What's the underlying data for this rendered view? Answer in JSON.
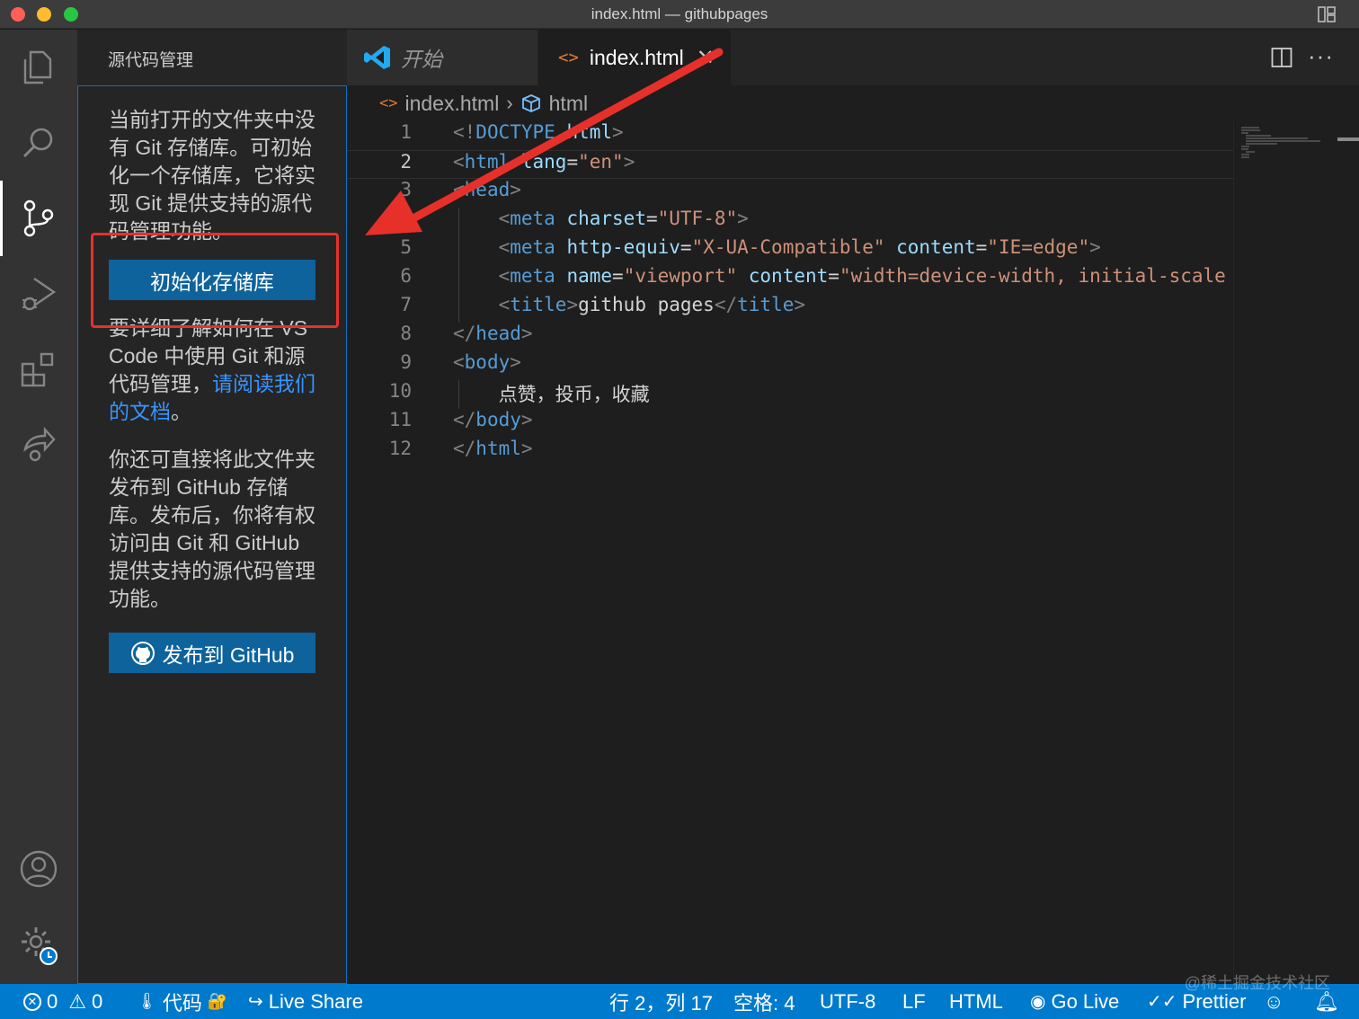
{
  "window": {
    "title": "index.html — githubpages"
  },
  "sidebar": {
    "header": "源代码管理",
    "intro": "当前打开的文件夹中没有 Git 存储库。可初始化一个存储库，它将实现 Git 提供支持的源代码管理功能。",
    "init_button": "初始化存储库",
    "learn_text": "要详细了解如何在 VS Code 中使用 Git 和源代码管理，",
    "learn_link": "请阅读我们的文档",
    "learn_suffix": "。",
    "publish_text": "你还可直接将此文件夹发布到 GitHub 存储库。发布后，你将有权访问由 Git 和 GitHub 提供支持的源代码管理功能。",
    "publish_button": "发布到 GitHub"
  },
  "tabs": [
    {
      "label": "开始",
      "icon": "vscode-logo-icon"
    },
    {
      "label": "index.html",
      "icon": "html-file-icon",
      "active": true
    }
  ],
  "breadcrumb": {
    "file": "index.html",
    "symbol": "html"
  },
  "editor": {
    "current_line": 2,
    "lines": [
      {
        "n": "1",
        "parts": [
          [
            "tg",
            "<!"
          ],
          [
            "tn",
            "DOCTYPE"
          ],
          [
            "at",
            " html"
          ],
          [
            "tg",
            ">"
          ]
        ]
      },
      {
        "n": "2",
        "parts": [
          [
            "tg",
            "<"
          ],
          [
            "tn",
            "html"
          ],
          [
            "at",
            " lang"
          ],
          [
            "tx",
            "="
          ],
          [
            "av",
            "\"en\""
          ],
          [
            "tg",
            ">"
          ]
        ]
      },
      {
        "n": "3",
        "parts": [
          [
            "tg",
            "<"
          ],
          [
            "tn",
            "head"
          ],
          [
            "tg",
            ">"
          ]
        ]
      },
      {
        "n": "4",
        "parts": [
          [
            "tx",
            "    "
          ],
          [
            "tg",
            "<"
          ],
          [
            "tn",
            "meta"
          ],
          [
            "at",
            " charset"
          ],
          [
            "tx",
            "="
          ],
          [
            "av",
            "\"UTF-8\""
          ],
          [
            "tg",
            ">"
          ]
        ]
      },
      {
        "n": "5",
        "parts": [
          [
            "tx",
            "    "
          ],
          [
            "tg",
            "<"
          ],
          [
            "tn",
            "meta"
          ],
          [
            "at",
            " http-equiv"
          ],
          [
            "tx",
            "="
          ],
          [
            "av",
            "\"X-UA-Compatible\""
          ],
          [
            "at",
            " content"
          ],
          [
            "tx",
            "="
          ],
          [
            "av",
            "\"IE=edge\""
          ],
          [
            "tg",
            ">"
          ]
        ]
      },
      {
        "n": "6",
        "parts": [
          [
            "tx",
            "    "
          ],
          [
            "tg",
            "<"
          ],
          [
            "tn",
            "meta"
          ],
          [
            "at",
            " name"
          ],
          [
            "tx",
            "="
          ],
          [
            "av",
            "\"viewport\""
          ],
          [
            "at",
            " content"
          ],
          [
            "tx",
            "="
          ],
          [
            "av",
            "\"width=device-width, initial-scale"
          ]
        ]
      },
      {
        "n": "7",
        "parts": [
          [
            "tx",
            "    "
          ],
          [
            "tg",
            "<"
          ],
          [
            "tn",
            "title"
          ],
          [
            "tg",
            ">"
          ],
          [
            "tx",
            "github pages"
          ],
          [
            "tg",
            "</"
          ],
          [
            "tn",
            "title"
          ],
          [
            "tg",
            ">"
          ]
        ]
      },
      {
        "n": "8",
        "parts": [
          [
            "tg",
            "</"
          ],
          [
            "tn",
            "head"
          ],
          [
            "tg",
            ">"
          ]
        ]
      },
      {
        "n": "9",
        "parts": [
          [
            "tg",
            "<"
          ],
          [
            "tn",
            "body"
          ],
          [
            "tg",
            ">"
          ]
        ]
      },
      {
        "n": "10",
        "parts": [
          [
            "tx",
            "    点赞，投币，收藏"
          ]
        ]
      },
      {
        "n": "11",
        "parts": [
          [
            "tg",
            "</"
          ],
          [
            "tn",
            "body"
          ],
          [
            "tg",
            ">"
          ]
        ]
      },
      {
        "n": "12",
        "parts": [
          [
            "tg",
            "</"
          ],
          [
            "tn",
            "html"
          ],
          [
            "tg",
            ">"
          ]
        ]
      }
    ]
  },
  "statusbar": {
    "errors": "0",
    "warnings": "0",
    "sync": "代码",
    "live_share": "Live Share",
    "position": "行 2，列 17",
    "spaces": "空格: 4",
    "encoding": "UTF-8",
    "eol": "LF",
    "language": "HTML",
    "go_live": "Go Live",
    "prettier": "Prettier"
  },
  "watermark": "@稀土掘金技术社区",
  "colors": {
    "accent": "#007acc",
    "button": "#0e639c",
    "annotation": "#e8302a",
    "link": "#3794ff"
  }
}
